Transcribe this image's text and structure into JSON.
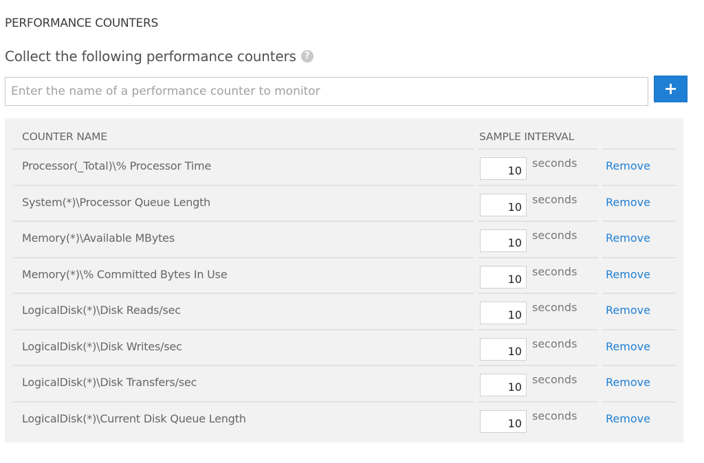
{
  "section": {
    "title": "PERFORMANCE COUNTERS",
    "subtitle": "Collect the following performance counters",
    "help_icon": "?"
  },
  "search": {
    "placeholder": "Enter the name of a performance counter to monitor",
    "value": "",
    "add_label": "+"
  },
  "table": {
    "headers": {
      "counter_name": "COUNTER NAME",
      "sample_interval": "SAMPLE INTERVAL"
    },
    "rows": [
      {
        "name": "Processor(_Total)\\% Processor Time",
        "interval": "10",
        "unit": "seconds",
        "action": "Remove"
      },
      {
        "name": "System(*)\\Processor Queue Length",
        "interval": "10",
        "unit": "seconds",
        "action": "Remove"
      },
      {
        "name": "Memory(*)\\Available MBytes",
        "interval": "10",
        "unit": "seconds",
        "action": "Remove"
      },
      {
        "name": "Memory(*)\\% Committed Bytes In Use",
        "interval": "10",
        "unit": "seconds",
        "action": "Remove"
      },
      {
        "name": "LogicalDisk(*)\\Disk Reads/sec",
        "interval": "10",
        "unit": "seconds",
        "action": "Remove"
      },
      {
        "name": "LogicalDisk(*)\\Disk Writes/sec",
        "interval": "10",
        "unit": "seconds",
        "action": "Remove"
      },
      {
        "name": "LogicalDisk(*)\\Disk Transfers/sec",
        "interval": "10",
        "unit": "seconds",
        "action": "Remove"
      },
      {
        "name": "LogicalDisk(*)\\Current Disk Queue Length",
        "interval": "10",
        "unit": "seconds",
        "action": "Remove"
      }
    ]
  },
  "colors": {
    "accent": "#1e7fd4",
    "panel_bg": "#f2f2f2"
  }
}
